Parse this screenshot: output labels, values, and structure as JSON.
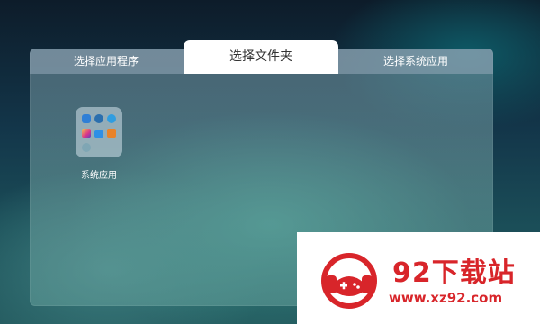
{
  "tabs": [
    {
      "label": "选择应用程序",
      "active": false
    },
    {
      "label": "选择文件夹",
      "active": true
    },
    {
      "label": "选择系统应用",
      "active": false
    }
  ],
  "folder": {
    "label": "系统应用",
    "icons": [
      "files-icon",
      "browser-icon",
      "user-icon",
      "gallery-icon",
      "folder-icon",
      "app-store-icon",
      "settings-icon"
    ]
  },
  "watermark": {
    "title": "92下载站",
    "url": "www.xz92.com"
  },
  "colors": {
    "accent_red": "#d8252a",
    "active_tab_bg": "#ffffff"
  }
}
